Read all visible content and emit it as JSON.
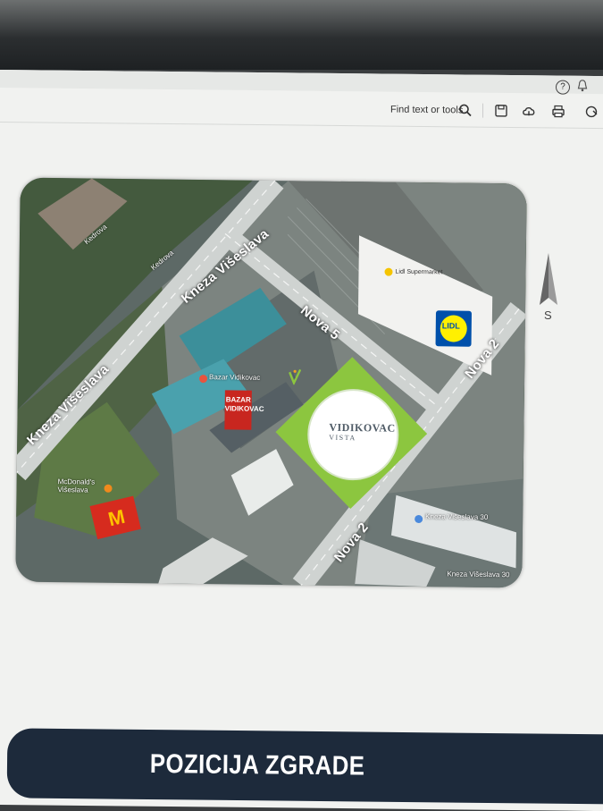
{
  "toolbar": {
    "find_label": "Find text or tools",
    "help_icon": "question-icon",
    "notify_icon": "bell-icon"
  },
  "map": {
    "streets": {
      "kneza_top": "Kneza Višeslava",
      "kneza_left": "Kneza Višeslava",
      "nova5": "Nova 5",
      "nova2_right": "Nova 2",
      "nova2_bottom": "Nova 2"
    },
    "small_labels": {
      "kedrova_1": "Kedrova",
      "kedrova_2": "Kedrova",
      "bazar_place": "Bazar Vidikovac",
      "mcdonalds_place": "McDonald's Višeslava",
      "address_1": "Kneza Višeslava 30",
      "address_2": "Kneza Višeslava 30"
    },
    "lidl": {
      "place": "Lidl Supermarket",
      "logo": "LIDL"
    },
    "bazar_sign": "BAZAR VIDIKOVAC",
    "mcdonalds_logo": "M",
    "project": {
      "name": "VIDIKOVAC",
      "subtitle": "VISTA"
    },
    "compass_letter": "S",
    "colors": {
      "project_green": "#8cc63f",
      "lidl_blue": "#0050aa",
      "lidl_yellow": "#fff000",
      "bazar_red": "#c8261f"
    }
  },
  "banner": {
    "title": "POZICIJA ZGRADE",
    "background": "#1d2a3b"
  }
}
